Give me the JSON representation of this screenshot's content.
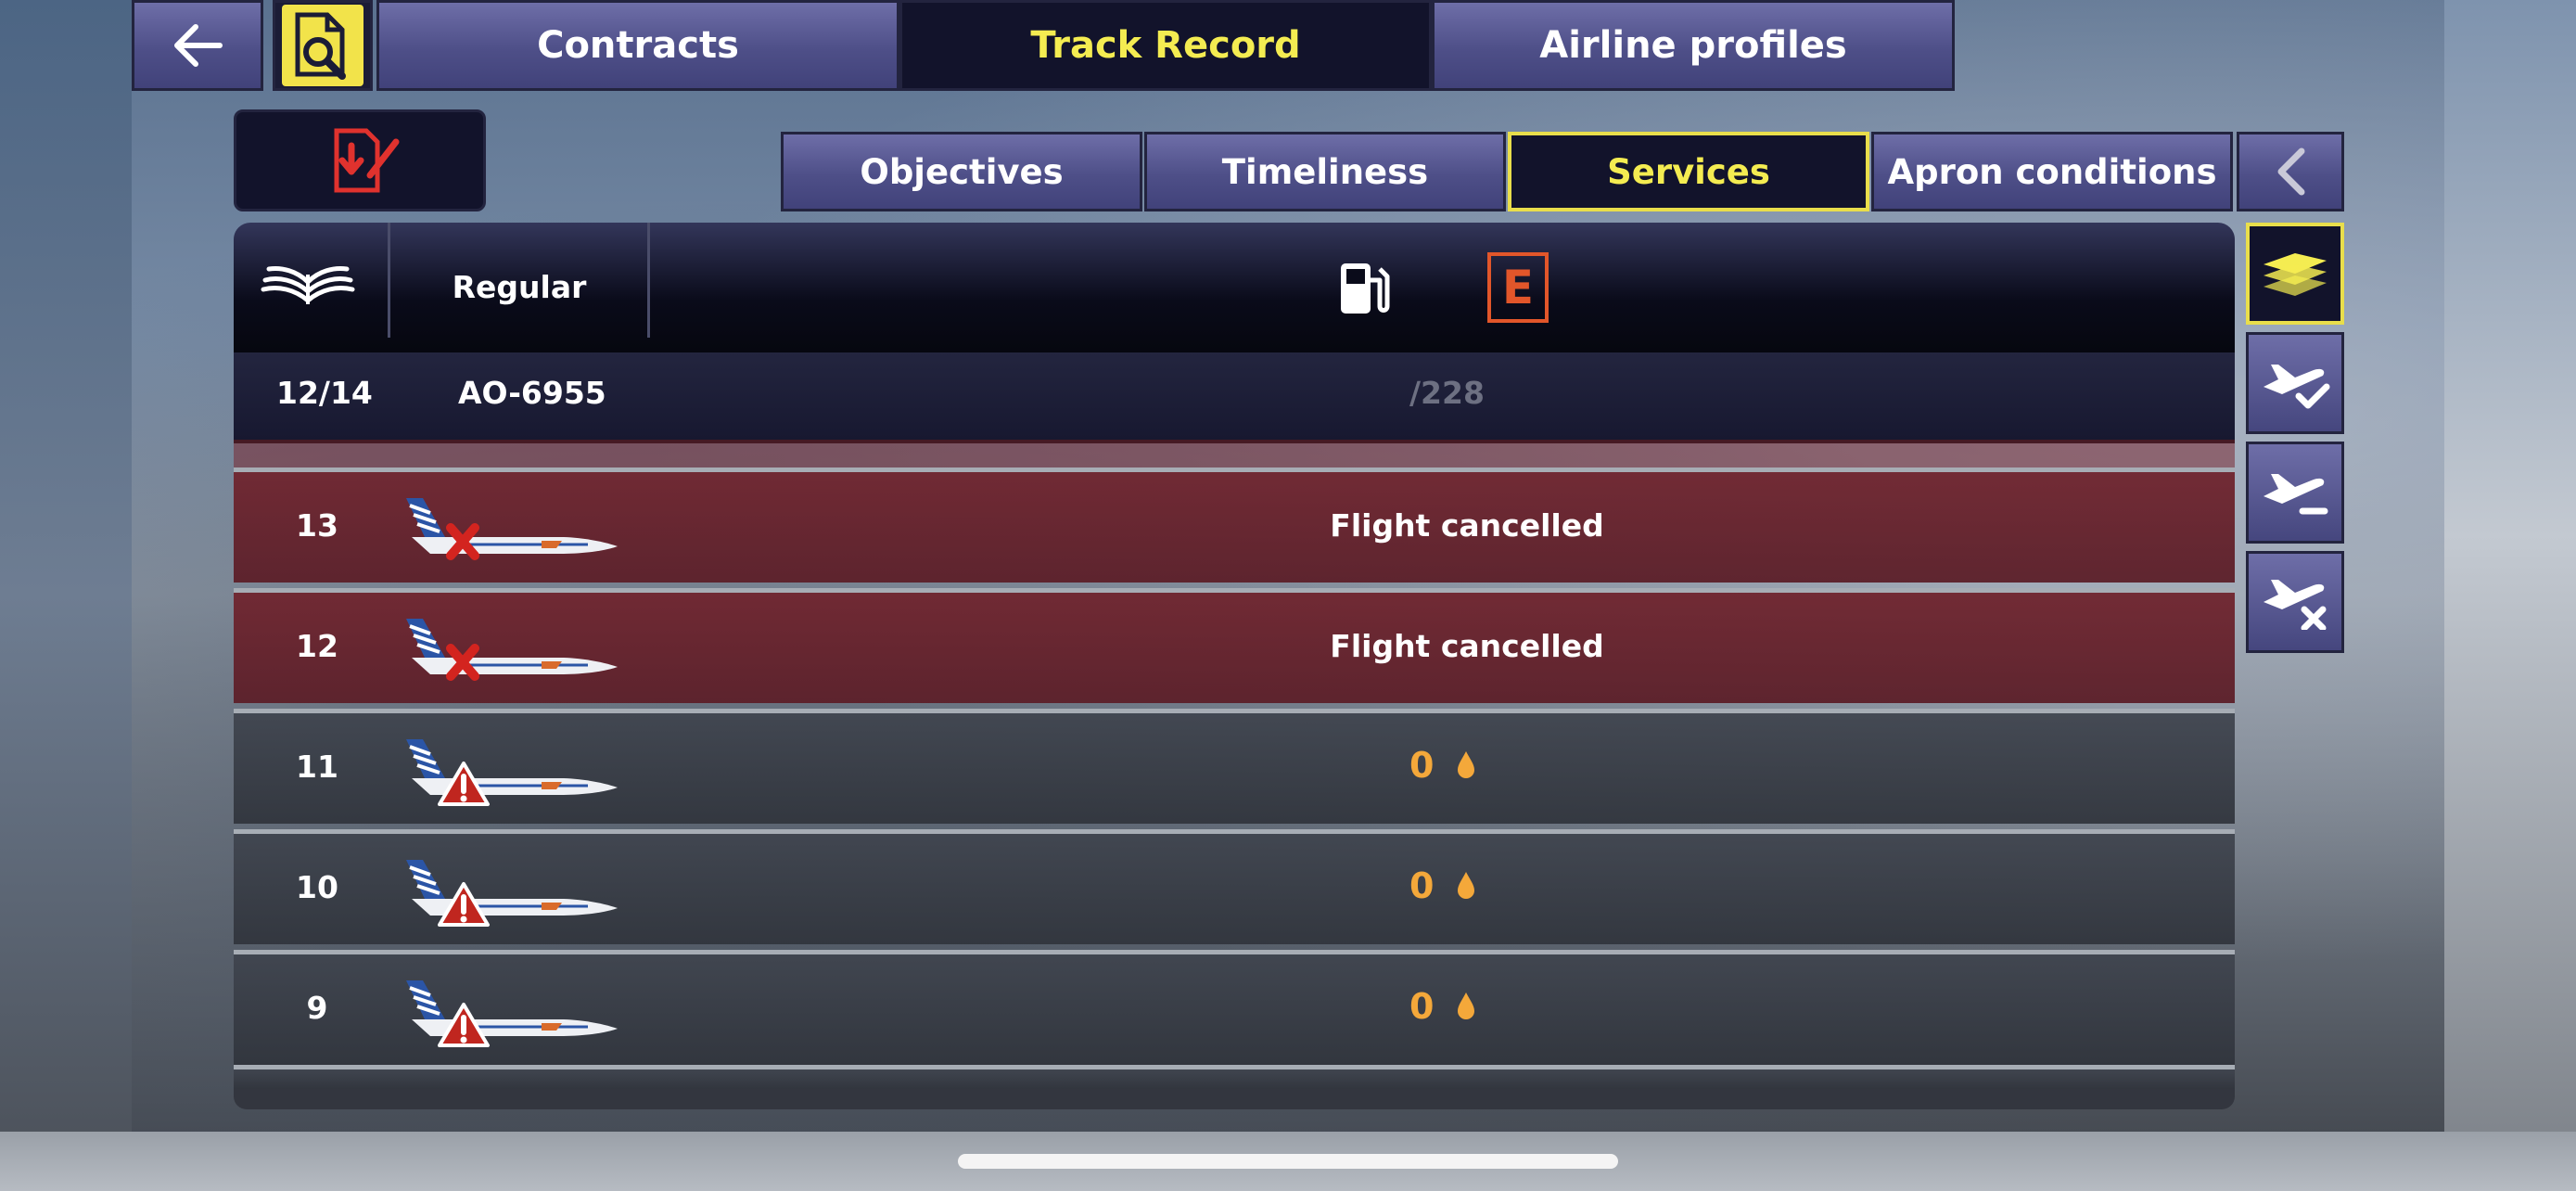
{
  "top_nav": {
    "back_icon": "arrow-left-icon",
    "search_icon": "document-search-icon",
    "tabs": [
      {
        "label": "Contracts",
        "active": false
      },
      {
        "label": "Track Record",
        "active": true
      },
      {
        "label": "Airline profiles",
        "active": false
      }
    ]
  },
  "export_icon": "document-export-icon",
  "sub_tabs": [
    {
      "label": "Objectives",
      "active": false
    },
    {
      "label": "Timeliness",
      "active": false
    },
    {
      "label": "Services",
      "active": true
    },
    {
      "label": "Apron conditions",
      "active": false
    }
  ],
  "sub_tabs_collapse_icon": "chevron-left-icon",
  "table": {
    "header": {
      "book_icon": "open-book-icon",
      "type_label": "Regular",
      "fuel_icon": "fuel-pump-icon",
      "energy_badge": "E"
    },
    "summary": {
      "count": "12/14",
      "flight_code": "AO-6955",
      "total": "/228"
    },
    "rows": [
      {
        "num": "13",
        "status": "cancelled",
        "message": "Flight cancelled"
      },
      {
        "num": "12",
        "status": "cancelled",
        "message": "Flight cancelled"
      },
      {
        "num": "11",
        "status": "warning",
        "value": "0"
      },
      {
        "num": "10",
        "status": "warning",
        "value": "0"
      },
      {
        "num": "9",
        "status": "warning",
        "value": "0"
      }
    ]
  },
  "side_filters": [
    {
      "icon": "stacked-planes-icon",
      "selected": true
    },
    {
      "icon": "plane-check-icon",
      "selected": false
    },
    {
      "icon": "plane-minus-icon",
      "selected": false
    },
    {
      "icon": "plane-cancel-icon",
      "selected": false
    }
  ],
  "colors": {
    "accent_yellow": "#f4ec51",
    "button_purple": "#4e4f88",
    "cancelled_row": "#702630",
    "value_orange": "#f4a83a",
    "badge_orange": "#e2562a"
  }
}
